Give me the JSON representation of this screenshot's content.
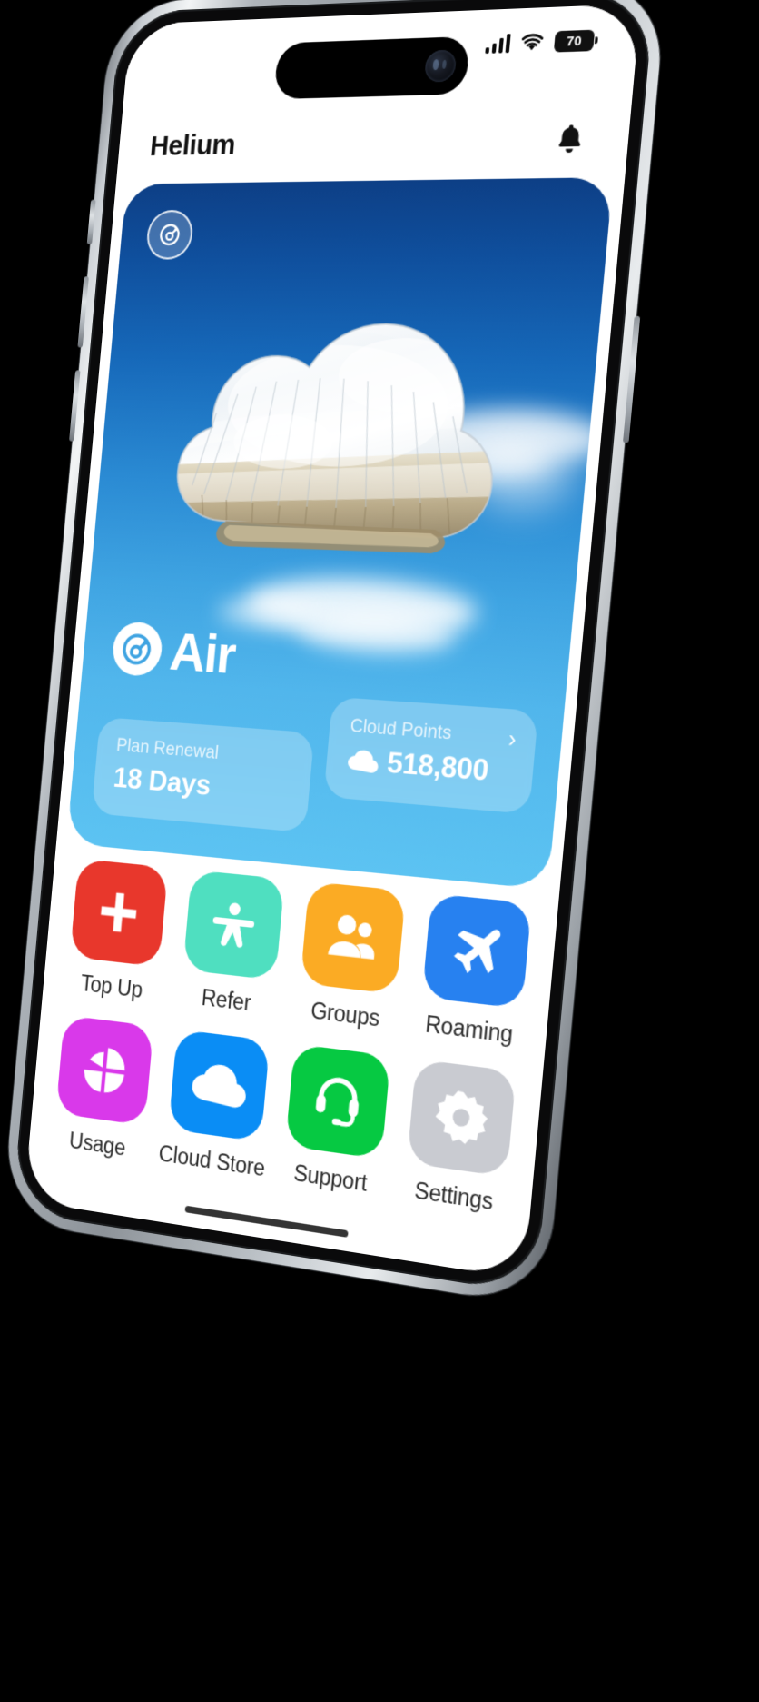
{
  "device": {
    "status_bar": {
      "signal_icon": "cellular-bars-icon",
      "wifi_icon": "wifi-icon",
      "battery_level": "70"
    }
  },
  "header": {
    "title": "Helium",
    "notification_icon": "bell-icon"
  },
  "hero": {
    "badge_icon": "helium-logo-icon",
    "image_alt": "silver-foil-cloud-balloon",
    "brand_logo_icon": "helium-logo-icon",
    "brand_name": "Air",
    "cards": [
      {
        "name": "plan-renewal",
        "label": "Plan Renewal",
        "value": "18 Days"
      },
      {
        "name": "cloud-points",
        "label": "Cloud Points",
        "value": "518,800",
        "icon": "cloud-icon",
        "chevron": "›"
      }
    ]
  },
  "grid": {
    "tiles": [
      {
        "label": "Top Up",
        "icon": "plus-icon",
        "color": "#e8372c"
      },
      {
        "label": "Refer",
        "icon": "person-icon",
        "color": "#4fdfc0"
      },
      {
        "label": "Groups",
        "icon": "people-icon",
        "color": "#fbab24"
      },
      {
        "label": "Roaming",
        "icon": "airplane-icon",
        "color": "#2781f0"
      },
      {
        "label": "Usage",
        "icon": "pie-chart-icon",
        "color": "#d939ea"
      },
      {
        "label": "Cloud Store",
        "icon": "cloud-icon",
        "color": "#0a8df5"
      },
      {
        "label": "Support",
        "icon": "headset-icon",
        "color": "#06c942"
      },
      {
        "label": "Settings",
        "icon": "gear-icon",
        "color": "#c9cbd1"
      }
    ]
  },
  "colors": {
    "hero_top": "#0d3f86",
    "hero_bottom": "#5cc3f2",
    "screen_bg": "#ffffff",
    "text_dark": "#121212"
  }
}
